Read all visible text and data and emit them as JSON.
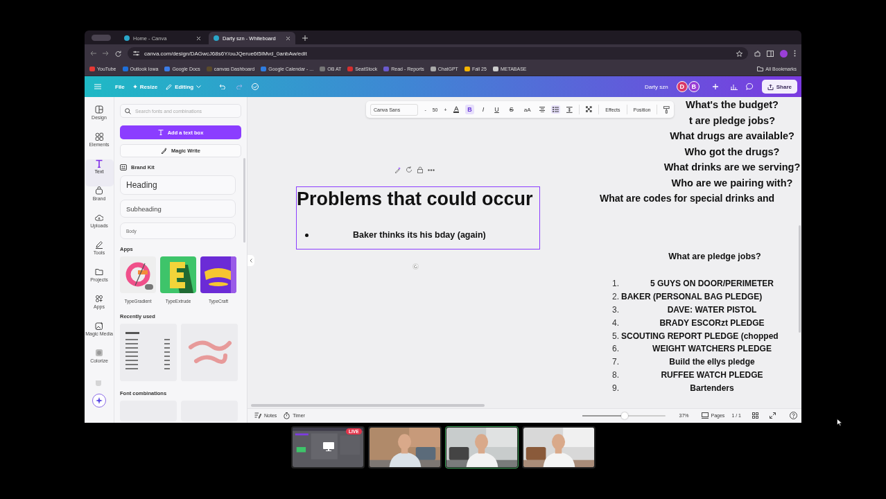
{
  "browser": {
    "tabs": [
      {
        "title": "Home - Canva",
        "selected": false
      },
      {
        "title": "Darty szn - Whiteboard",
        "selected": true
      }
    ],
    "url": "canva.com/design/DAGwcJ68s6Y/ouJQerue6t5IMvd_0anbAw/edit",
    "bookmarks": [
      "YouTube",
      "Outlook Iowa",
      "Google Docs",
      "canvas Dashboard",
      "Google Calendar - ...",
      "OB AT",
      "SeatStock",
      "Read - Reports",
      "ChatGPT",
      "Fall 25",
      "METABASE"
    ],
    "all_bookmarks": "All Bookmarks"
  },
  "header": {
    "menu": "File",
    "resize": "Resize",
    "mode": "Editing",
    "title": "Darty szn",
    "collaborators": [
      {
        "initial": "D",
        "color": "#d93a6a"
      },
      {
        "initial": "B",
        "color": "#9a3fd6"
      }
    ],
    "share": "Share"
  },
  "rail": [
    {
      "label": "Design",
      "selected": false
    },
    {
      "label": "Elements",
      "selected": false
    },
    {
      "label": "Text",
      "selected": true
    },
    {
      "label": "Brand",
      "selected": false
    },
    {
      "label": "Uploads",
      "selected": false
    },
    {
      "label": "Tools",
      "selected": false
    },
    {
      "label": "Projects",
      "selected": false
    },
    {
      "label": "Apps",
      "selected": false
    },
    {
      "label": "Magic Media",
      "selected": false
    },
    {
      "label": "Colorize",
      "selected": false
    }
  ],
  "panel": {
    "search_placeholder": "Search fonts and combinations",
    "add_text": "Add a text box",
    "magic_write": "Magic Write",
    "brand_kit": "Brand Kit",
    "styles": [
      {
        "label": "Heading",
        "kind": "heading"
      },
      {
        "label": "Subheading",
        "kind": "subheading"
      },
      {
        "label": "Body",
        "kind": "body"
      }
    ],
    "apps_title": "Apps",
    "apps": [
      {
        "name": "TypeGradient",
        "kind": "gradient"
      },
      {
        "name": "TypeExtrude",
        "kind": "extrude"
      },
      {
        "name": "TypeCraft",
        "kind": "craft"
      }
    ],
    "recent_title": "Recently used",
    "font_combinations_title": "Font combinations"
  },
  "text_toolbar": {
    "font": "Canva Sans",
    "decrease": "-",
    "size": "50",
    "increase": "+",
    "format_buttons": [
      {
        "label": "B",
        "kind": "bold",
        "on": true
      },
      {
        "label": "I",
        "kind": "italic",
        "on": false
      },
      {
        "label": "U",
        "kind": "underline",
        "on": false
      },
      {
        "label": "S",
        "kind": "strike",
        "on": false
      },
      {
        "label": "aA",
        "kind": "case",
        "on": false
      }
    ],
    "bullets_on": true,
    "effects": "Effects",
    "position": "Position"
  },
  "canvas": {
    "text_box": {
      "heading": "Problems that could occur",
      "bullets": [
        "Baker thinks its his bday (again)"
      ],
      "selected": true
    },
    "questions": [
      "What's the budget?",
      "t are pledge jobs?",
      "What drugs are available?",
      "Who got the drugs?",
      "What drinks are we serving?",
      "Who are we pairing with?",
      "What are codes for special drinks and"
    ],
    "jobs_title": "What are pledge jobs?",
    "jobs": [
      {
        "number": "1.",
        "text": "5 GUYS ON DOOR/PERIMETER"
      },
      {
        "number": "2.",
        "text": "BAKER (PERSONAL BAG PLEDGE)"
      },
      {
        "number": "3.",
        "text": "DAVE: WATER PISTOL"
      },
      {
        "number": "4.",
        "text": "BRADY ESCORzt PLEDGE"
      },
      {
        "number": "5.",
        "text": "SCOUTING REPORT PLEDGE (chopped"
      },
      {
        "number": "6.",
        "text": "WEIGHT WATCHERS PLEDGE"
      },
      {
        "number": "7.",
        "text": "Build the ellys pledge"
      },
      {
        "number": "8.",
        "text": "RUFFEE WATCH PLEDGE"
      },
      {
        "number": "9.",
        "text": "Bartenders"
      }
    ]
  },
  "bottom_bar": {
    "notes": "Notes",
    "timer": "Timer",
    "zoom": {
      "level": 0.51
    },
    "zoom_text": "37%",
    "pages": "Pages",
    "page_count": "1 / 1"
  },
  "call": {
    "tiles": [
      {
        "kind": "screen_share",
        "badge": "LIVE",
        "speaking": false
      },
      {
        "kind": "camera",
        "speaking": false
      },
      {
        "kind": "camera",
        "speaking": true
      },
      {
        "kind": "camera",
        "speaking": false
      }
    ]
  }
}
